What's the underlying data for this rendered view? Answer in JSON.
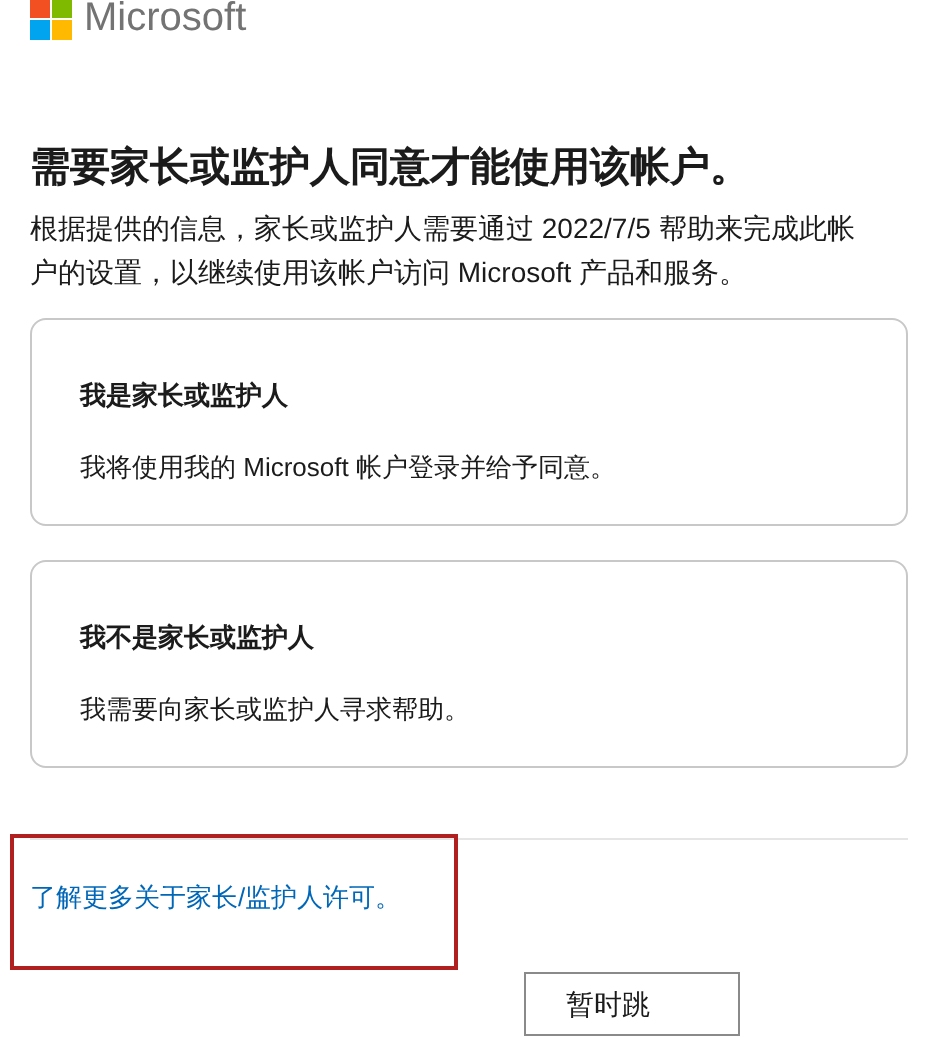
{
  "brand": "Microsoft",
  "title": "需要家长或监护人同意才能使用该帐户。",
  "description": "根据提供的信息，家长或监护人需要通过 2022/7/5 帮助来完成此帐户的设置，以继续使用该帐户访问 Microsoft 产品和服务。",
  "options": [
    {
      "title": "我是家长或监护人",
      "text": "我将使用我的 Microsoft 帐户登录并给予同意。"
    },
    {
      "title": "我不是家长或监护人",
      "text": "我需要向家长或监护人寻求帮助。"
    }
  ],
  "link": "了解更多关于家长/监护人许可。",
  "link_highlighted": true,
  "button": "暂时跳"
}
